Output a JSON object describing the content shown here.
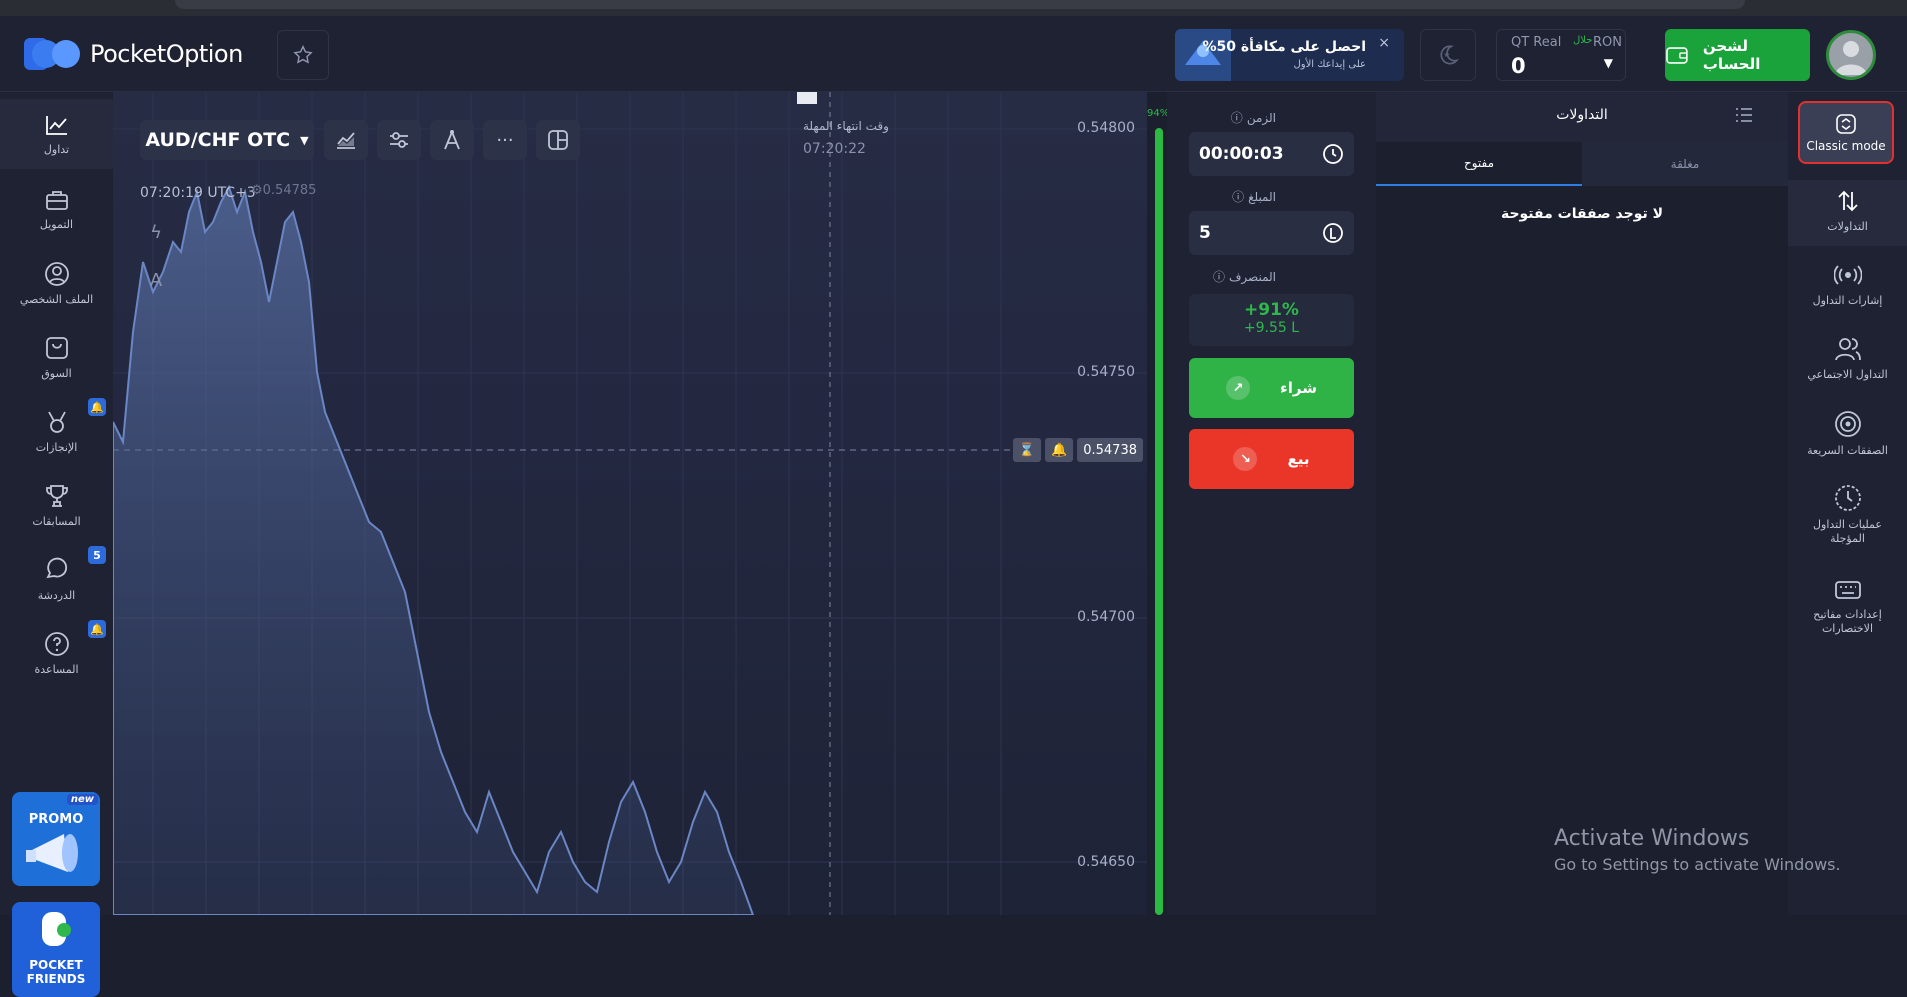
{
  "app": {
    "brand": "PocketOption"
  },
  "header": {
    "promo_title": "%احصل على مكافأة 50",
    "promo_sub": "على إيداعك الأول",
    "promo_close": "×",
    "account_type": "QT Real",
    "halal": "حلال",
    "currency": "RON",
    "balance": "0",
    "deposit_label": "لشحن الحساب"
  },
  "left_nav": {
    "items": [
      {
        "label": "تداول",
        "icon": "chart-line-icon"
      },
      {
        "label": "التمويل",
        "icon": "briefcase-icon"
      },
      {
        "label": "الملف الشخصي",
        "icon": "user-icon"
      },
      {
        "label": "السوق",
        "icon": "shopping-bag-icon"
      },
      {
        "label": "الإنجازات",
        "icon": "achievements-icon"
      },
      {
        "label": "المسابقات",
        "icon": "trophy-icon"
      },
      {
        "label": "الدردشة",
        "icon": "chat-icon",
        "badge": "5"
      },
      {
        "label": "المساعدة",
        "icon": "help-icon"
      }
    ],
    "promo_new": "new",
    "promo_label": "PROMO",
    "friends_label_1": "POCKET",
    "friends_label_2": "FRIENDS"
  },
  "chart": {
    "pair": "AUD/CHF OTC",
    "time": "07:20:19 UTC+3",
    "last_price_hint": "0.54785",
    "expiry_label": "وقت انتهاء المهلة",
    "expiry_time": "07:20:22",
    "price_levels": [
      "0.54800",
      "0.54750",
      "0.54700",
      "0.54650"
    ],
    "current_price": "0.54738",
    "tool_a": "A"
  },
  "gauge": {
    "percent": "94%"
  },
  "trade_panel": {
    "time_label": "الزمن",
    "time_value": "00:00:03",
    "amount_label": "المبلغ",
    "amount_value": "5",
    "payout_label": "المنصرف",
    "payout_percent": "+91%",
    "payout_amount": "+9.55 L",
    "buy_label": "شراء",
    "sell_label": "بيع"
  },
  "trades": {
    "title": "التداولات",
    "tab_open": "مفتوح",
    "tab_closed": "مغلقة",
    "empty": "لا توجد صفقات مفتوحة"
  },
  "right_nav": {
    "classic_mode": "Classic mode",
    "items": [
      {
        "label": "التداولات",
        "icon": "trades-arrows-icon"
      },
      {
        "label": "إشارات التداول",
        "icon": "signal-icon"
      },
      {
        "label": "التداول الاجتماعي",
        "icon": "social-users-icon"
      },
      {
        "label": "الصفقات السريعة",
        "icon": "target-icon"
      },
      {
        "label": "عمليات التداول المؤجلة",
        "icon": "clock-icon"
      },
      {
        "label": "إعدادات مفاتيح الاختصارات",
        "icon": "keyboard-icon"
      }
    ]
  },
  "os_overlay": {
    "activate_title": "Activate Windows",
    "activate_sub": "Go to Settings to activate Windows."
  }
}
